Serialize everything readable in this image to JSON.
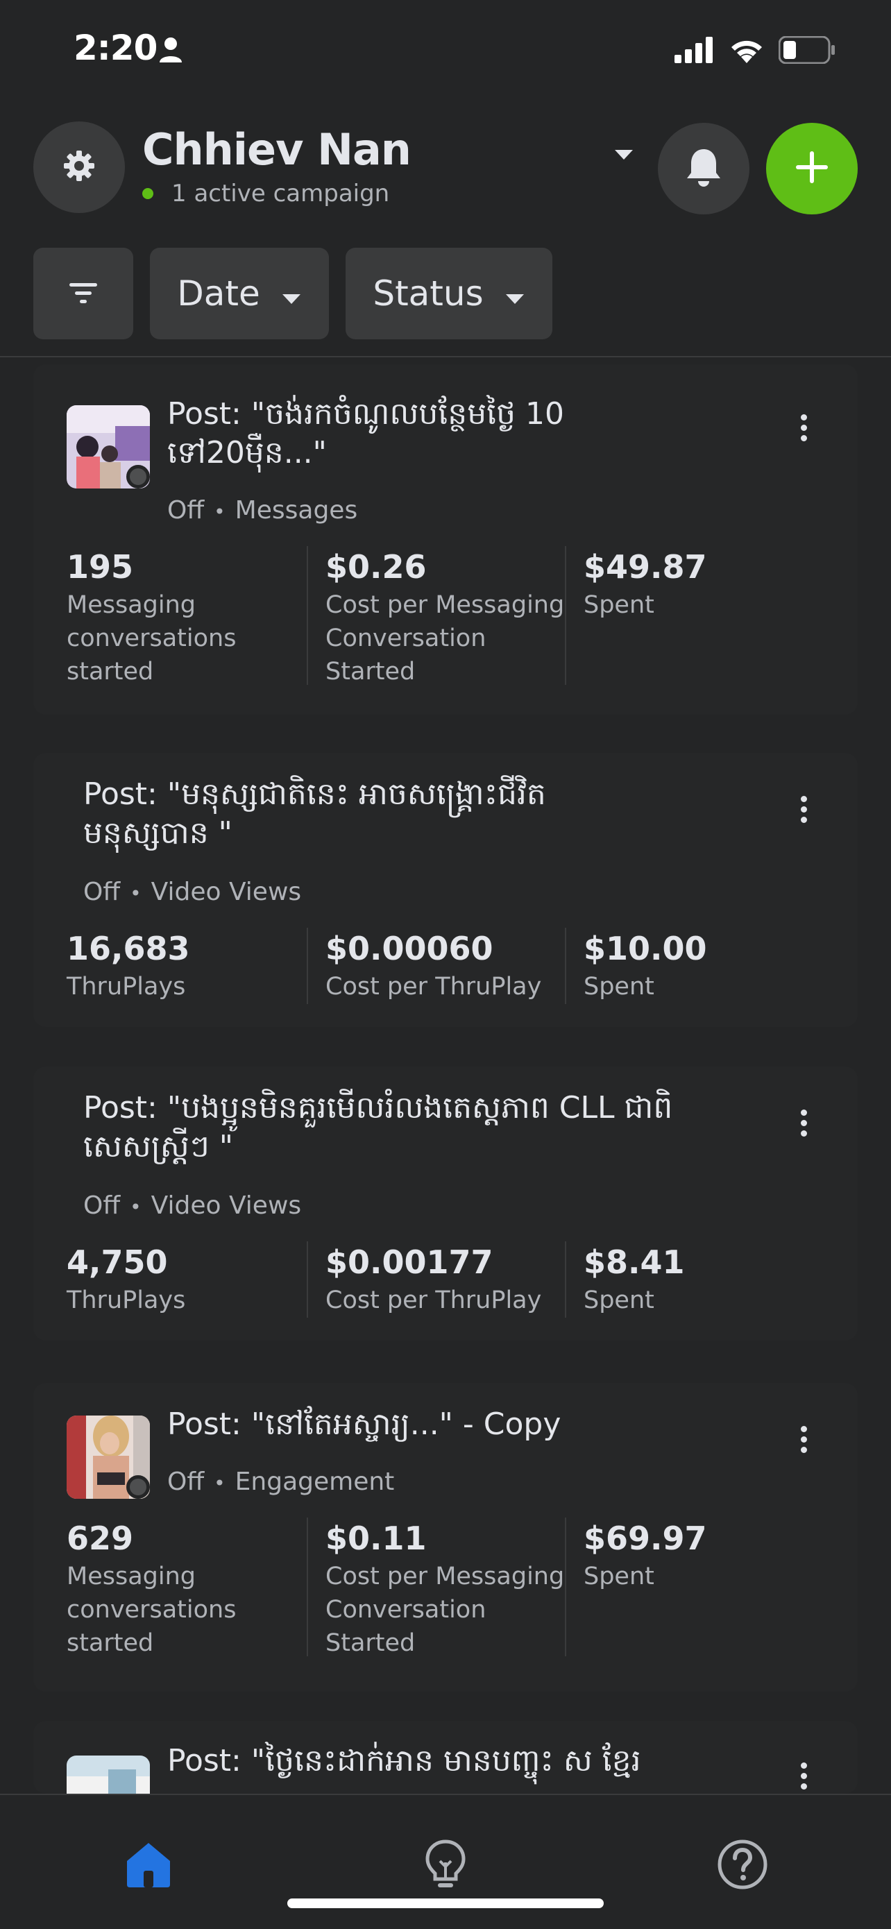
{
  "status_bar": {
    "time": "2:20"
  },
  "header": {
    "account_name": "Chhiev Nan",
    "account_status": "1 active campaign",
    "status_color": "#5fbe16",
    "accent_color": "#5fbe16"
  },
  "filters": {
    "date_label": "Date",
    "status_label": "Status"
  },
  "campaigns": [
    {
      "title_line1": "Post: \"ចង់រកចំណូលបន្ថែមថ្ងៃ 10",
      "title_line2": "ទៅ20ម៉ឺន...\"",
      "status": "Off",
      "objective": "Messages",
      "metrics": [
        {
          "value": "195",
          "label": "Messaging conversations started"
        },
        {
          "value": "$0.26",
          "label": "Cost per Messaging Conversation Started"
        },
        {
          "value": "$49.87",
          "label": "Spent"
        }
      ]
    },
    {
      "title_line1": "Post: \"មនុស្សជាតិនេះ អាចសង្គ្រោះជីវិត",
      "title_line2": "មនុស្សបាន \"",
      "status": "Off",
      "objective": "Video Views",
      "metrics": [
        {
          "value": "16,683",
          "label": "ThruPlays"
        },
        {
          "value": "$0.00060",
          "label": "Cost per ThruPlay"
        },
        {
          "value": "$10.00",
          "label": "Spent"
        }
      ]
    },
    {
      "title_line1": "Post: \"បងប្អូនមិនគួរមើលរំលងតេស្តភាព CLL ជាពិ",
      "title_line2": "សេសស្ត្រីៗ \"",
      "status": "Off",
      "objective": "Video Views",
      "metrics": [
        {
          "value": "4,750",
          "label": "ThruPlays"
        },
        {
          "value": "$0.00177",
          "label": "Cost per ThruPlay"
        },
        {
          "value": "$8.41",
          "label": "Spent"
        }
      ]
    },
    {
      "title_line1": "Post: \"នៅតែអស្ចារ្យ...\" - Copy",
      "status": "Off",
      "objective": "Engagement",
      "metrics": [
        {
          "value": "629",
          "label": "Messaging conversations started"
        },
        {
          "value": "$0.11",
          "label": "Cost per Messaging Conversation Started"
        },
        {
          "value": "$69.97",
          "label": "Spent"
        }
      ]
    },
    {
      "title_line1": "Post: \"ថ្ងៃនេះដាក់អាន មានបញ្ចុះ ស ខ្មែរ"
    }
  ],
  "icons": {
    "settings": "gear-icon",
    "bell": "bell-icon",
    "add": "plus-icon",
    "filter": "filter-icon",
    "home": "home-icon",
    "ideas": "lightbulb-icon",
    "help": "help-icon"
  },
  "nav_active_color": "#2374e1"
}
